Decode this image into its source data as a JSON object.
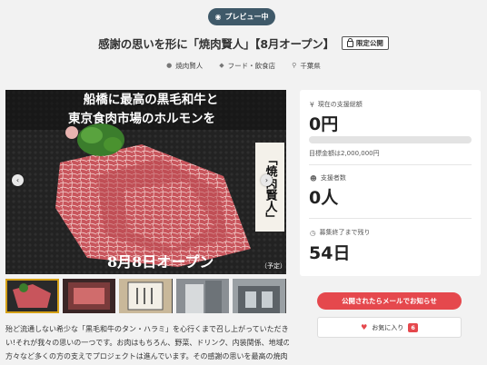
{
  "preview": {
    "icon": "eye-icon",
    "label": "プレビュー中"
  },
  "project": {
    "title": "感謝の思いを形に「焼肉賢人」【8月オープン】",
    "visibility": "限定公開"
  },
  "meta": {
    "owner": "焼肉賢人",
    "category": "フード・飲食店",
    "location": "千葉県"
  },
  "hero_image": {
    "banner_line1": "船橋に最高の黒毛和牛と",
    "banner_line2": "東京食肉市場のホルモンを",
    "vertical_sign": "「焼肉賢人」",
    "opening": "8月8日オープン",
    "opening_note": "（予定）"
  },
  "description": {
    "line1": "殆ど流通しない希少な「黒毛和牛のタン・ハラミ」を心行くまで召し上がっていただきた",
    "line2": "い!それが我々の思いの一つです。お肉はもちろん、野菜、ドリンク、内装関係、地域の",
    "line3": "方々など多くの方の支えでプロジェクトは進んでいます。その感謝の思いを最高の焼肉とい"
  },
  "stats": {
    "funding_label": "現在の支援総額",
    "funding_value": "0円",
    "progress_percent": 0,
    "target_text": "目標金額は2,000,000円",
    "supporters_label": "支援者数",
    "supporters_value": "0人",
    "days_label": "募集終了まで残り",
    "days_value": "54日"
  },
  "actions": {
    "notify_label": "公開されたらメールでお知らせ",
    "favorite_label": "お気に入り",
    "favorite_count": "6"
  },
  "colors": {
    "accent": "#e5484d",
    "pill": "#3f5969"
  }
}
